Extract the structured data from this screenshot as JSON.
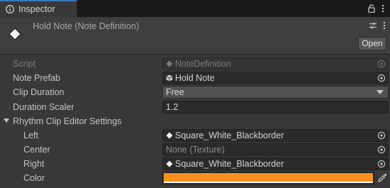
{
  "tab": {
    "label": "Inspector",
    "icon": "info-icon"
  },
  "header": {
    "title": "Hold Note (Note Definition)",
    "open_label": "Open",
    "icon": "scriptable-object-icon"
  },
  "fields": {
    "script": {
      "label": "Script",
      "value": "NoteDefinition"
    },
    "note_prefab": {
      "label": "Note Prefab",
      "value": "Hold Note"
    },
    "clip_duration": {
      "label": "Clip Duration",
      "value": "Free"
    },
    "duration_scaler": {
      "label": "Duration Scaler",
      "value": "1.2"
    }
  },
  "rhythm_settings": {
    "label": "Rhythm Clip Editor Settings",
    "left": {
      "label": "Left",
      "value": "Square_White_Blackborder"
    },
    "center": {
      "label": "Center",
      "value": "None (Texture)"
    },
    "right": {
      "label": "Right",
      "value": "Square_White_Blackborder"
    },
    "color": {
      "label": "Color",
      "hex": "#f7901d"
    }
  },
  "colors": {
    "accent": "#3a79bb",
    "note_color": "#f7901d"
  }
}
